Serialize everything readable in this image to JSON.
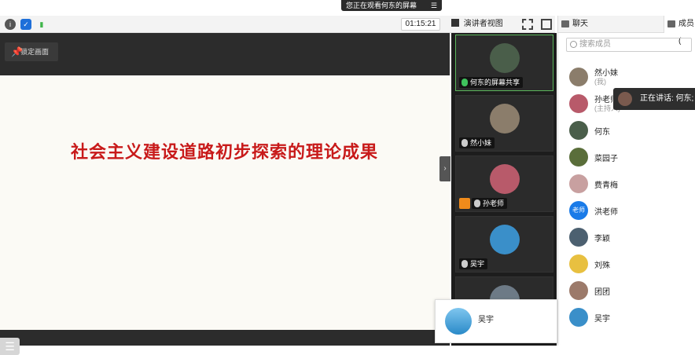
{
  "banner": {
    "text": "您正在观看何东的屏幕",
    "menu_icon": "list-menu-icon"
  },
  "toolbar": {
    "timer": "01:15:21",
    "view_mode": "演讲者视图",
    "icons": [
      "info-icon",
      "shield-icon",
      "signal-icon",
      "fullscreen-icon",
      "sidebar-toggle-icon"
    ]
  },
  "stage": {
    "pin_label": "锁定画面",
    "slide_title": "社会主义建设道路初步探索的理论成果"
  },
  "videos": [
    {
      "name": "何东的屏幕共享",
      "mic": "on",
      "active": true,
      "avatar_color": "#4a5e4a"
    },
    {
      "name": "然小妹",
      "mic": "muted",
      "active": false,
      "avatar_color": "#8b7d6b"
    },
    {
      "name": "孙老师",
      "mic": "muted",
      "active": false,
      "avatar_color": "#b85a6a",
      "badge": true
    },
    {
      "name": "吴宇",
      "mic": "muted",
      "active": false,
      "avatar_color": "#3a8fc9"
    },
    {
      "name": "",
      "mic": "",
      "active": false,
      "avatar_color": "#6d7a86"
    }
  ],
  "side": {
    "tabs": [
      {
        "label": "聊天",
        "icon": "chat-icon"
      },
      {
        "label": "成员(",
        "icon": "members-icon"
      }
    ],
    "search_placeholder": "搜索成员",
    "members": [
      {
        "name": "然小妹",
        "sub": "(我)",
        "color": "#8b7d6b",
        "text": ""
      },
      {
        "name": "孙老师",
        "sub": "(主持人)",
        "color": "#b85a6a",
        "text": ""
      },
      {
        "name": "何东",
        "sub": "",
        "color": "#4a5e4a",
        "text": ""
      },
      {
        "name": "菜园子",
        "sub": "",
        "color": "#5a6e3a",
        "text": ""
      },
      {
        "name": "费青梅",
        "sub": "",
        "color": "#c8a0a0",
        "text": ""
      },
      {
        "name": "洪老师",
        "sub": "",
        "color": "#1a7be8",
        "text": "老师"
      },
      {
        "name": "李颖",
        "sub": "",
        "color": "#4c6070",
        "text": ""
      },
      {
        "name": "刘殊",
        "sub": "",
        "color": "#e8c040",
        "text": ""
      },
      {
        "name": "团团",
        "sub": "",
        "color": "#9c7a6a",
        "text": ""
      },
      {
        "name": "吴宇",
        "sub": "",
        "color": "#3a8fc9",
        "text": ""
      }
    ]
  },
  "speaking": {
    "text": "正在讲话: 何东;"
  },
  "popup": {
    "name": "吴宇"
  }
}
